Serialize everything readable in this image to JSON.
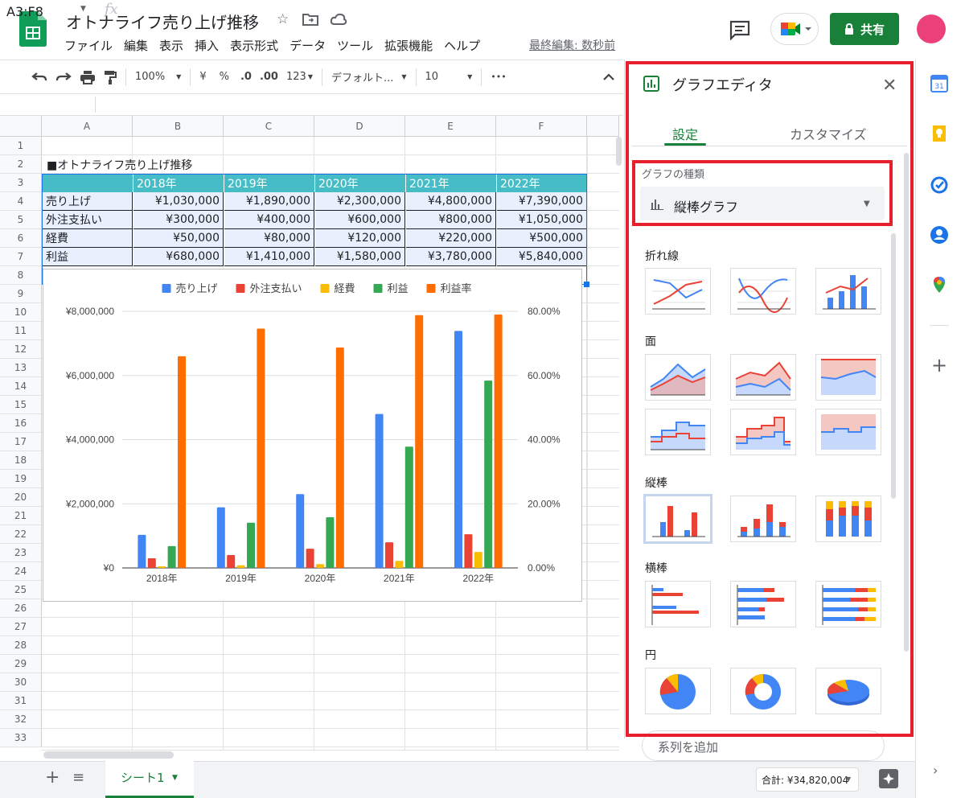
{
  "app": {
    "doc_title": "オトナライフ売り上げ推移",
    "menu": [
      "ファイル",
      "編集",
      "表示",
      "挿入",
      "表示形式",
      "データ",
      "ツール",
      "拡張機能",
      "ヘルプ"
    ],
    "last_edit": "最終編集: 数秒前",
    "share_label": "共有",
    "colors": {
      "brand_green": "#188038",
      "selection_red": "#e8202e",
      "header_teal": "#46bdc6",
      "avatar": "#ec407a"
    }
  },
  "toolbar": {
    "zoom": "100%",
    "currency": "¥",
    "percent": "%",
    "dec_decrease": ".0",
    "dec_increase": ".00",
    "more_formats": "123",
    "font": "デフォルト...",
    "font_size": "10",
    "more": "•••"
  },
  "formula_bar": {
    "name_box": "A3:F8",
    "fx": "fx"
  },
  "sheet": {
    "columns": [
      "A",
      "B",
      "C",
      "D",
      "E",
      "F"
    ],
    "rows": [
      "1",
      "2",
      "3",
      "4",
      "5",
      "6",
      "7",
      "8",
      "9",
      "10",
      "11",
      "12",
      "13",
      "14",
      "15",
      "16",
      "17",
      "18",
      "19",
      "20",
      "21",
      "22",
      "23",
      "24",
      "25",
      "26",
      "27",
      "28",
      "29",
      "30",
      "31",
      "32",
      "33"
    ],
    "title_cell": "■オトナライフ売り上げ推移",
    "header_row": [
      "",
      "2018年",
      "2019年",
      "2020年",
      "2021年",
      "2022年"
    ],
    "body_rows": [
      [
        "売り上げ",
        "¥1,030,000",
        "¥1,890,000",
        "¥2,300,000",
        "¥4,800,000",
        "¥7,390,000"
      ],
      [
        "外注支払い",
        "¥300,000",
        "¥400,000",
        "¥600,000",
        "¥800,000",
        "¥1,050,000"
      ],
      [
        "経費",
        "¥50,000",
        "¥80,000",
        "¥120,000",
        "¥220,000",
        "¥500,000"
      ],
      [
        "利益",
        "¥680,000",
        "¥1,410,000",
        "¥1,580,000",
        "¥3,780,000",
        "¥5,840,000"
      ]
    ]
  },
  "chart_data": {
    "type": "bar",
    "categories": [
      "2018年",
      "2019年",
      "2020年",
      "2021年",
      "2022年"
    ],
    "series": [
      {
        "name": "売り上げ",
        "color": "#4285f4",
        "axis": "left",
        "values": [
          1030000,
          1890000,
          2300000,
          4800000,
          7390000
        ]
      },
      {
        "name": "外注支払い",
        "color": "#ea4335",
        "axis": "left",
        "values": [
          300000,
          400000,
          600000,
          800000,
          1050000
        ]
      },
      {
        "name": "経費",
        "color": "#fbbc04",
        "axis": "left",
        "values": [
          50000,
          80000,
          120000,
          220000,
          500000
        ]
      },
      {
        "name": "利益",
        "color": "#34a853",
        "axis": "left",
        "values": [
          680000,
          1410000,
          1580000,
          3780000,
          5840000
        ]
      },
      {
        "name": "利益率",
        "color": "#ff6d01",
        "axis": "right",
        "values": [
          66.0,
          74.6,
          68.7,
          78.8,
          79.0
        ]
      }
    ],
    "y_left": {
      "ticks": [
        0,
        2000000,
        4000000,
        6000000,
        8000000
      ],
      "tick_labels": [
        "¥0",
        "¥2,000,000",
        "¥4,000,000",
        "¥6,000,000",
        "¥8,000,000"
      ],
      "lim": [
        0,
        8000000
      ]
    },
    "y_right": {
      "ticks": [
        0,
        20,
        40,
        60,
        80
      ],
      "tick_labels": [
        "0.00%",
        "20.00%",
        "40.00%",
        "60.00%",
        "80.00%"
      ],
      "lim": [
        0,
        80
      ]
    },
    "legend": "top",
    "grid": true
  },
  "panel": {
    "title": "グラフエディタ",
    "tabs": [
      "設定",
      "カスタマイズ"
    ],
    "chart_type_label": "グラフの種類",
    "chart_type_value": "縦棒グラフ",
    "sections": {
      "line": "折れ線",
      "area": "面",
      "column": "縦棒",
      "bar": "横棒",
      "pie": "円"
    },
    "add_series": "系列を追加"
  },
  "bottom": {
    "sheet_tab": "シート1",
    "sum": "合計: ¥34,820,004"
  }
}
